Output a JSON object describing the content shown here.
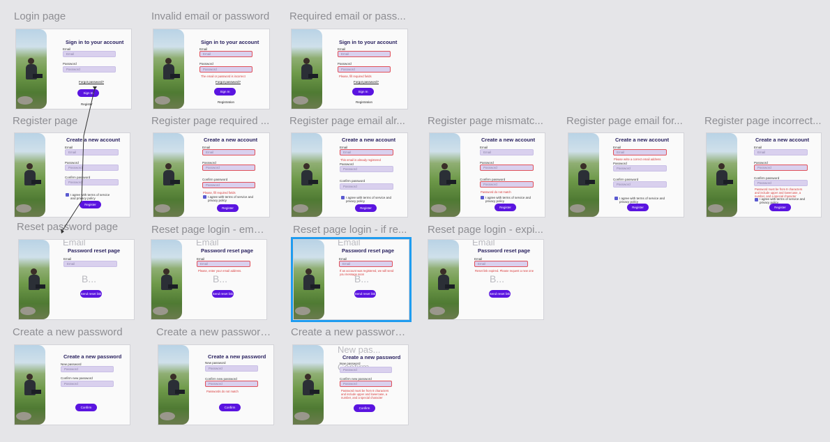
{
  "labels": [
    "Login page",
    "Invalid email or password",
    "Required email or pass...",
    "Register page",
    "Register page required ...",
    "Register page email alr...",
    "Register page mismatc...",
    "Register page email for...",
    "Register page incorrect...",
    "Reset password page",
    "Reset page login - emai...",
    "Reset page login - if re...",
    "Reset page login - expi...",
    "Create a new password",
    "Create a new password...",
    "Create a new password..."
  ],
  "text": {
    "sign_in_title": "Sign in to your account",
    "email": "Email",
    "password": "Password",
    "forgot": "Forgot password?",
    "sign_in": "Sign In",
    "register_link": "Registration",
    "register_link_short": "Register",
    "err_invalid": "The email or password is incorrect",
    "err_required": "Please, fill required fields",
    "create_title": "Create a new account",
    "confirm_password": "Confirm password",
    "terms": "I agree with terms of service and privacy policy",
    "register": "Register",
    "err_email_registered": "This email is already registered",
    "err_mismatch": "Password do not match",
    "err_email_format": "Please write a correct email address",
    "err_password_rules": "Password must be from 8 characters and include upper and lowercase, a number, and a special character",
    "reset_title": "Password reset page",
    "send_reset": "Send reset link",
    "ghost_b": "B...",
    "err_enter_email": "Please, enter your email address.",
    "err_if_registered": "If an account was registered, we will send you message soon",
    "err_expired": "Reset link expired. Please request a new one",
    "new_pw_title": "Create a new password",
    "new_password": "New password",
    "confirm_new_password": "Confirm new password",
    "confirm": "Confirm",
    "err_pw_mismatch": "Passwords do not match",
    "err_pw_rules": "Password must be from 8 characters and include upper and lowercase, a number, and a special character",
    "ghost_new_pass": "New pas...",
    "ghost_confirm": "Confirm"
  }
}
